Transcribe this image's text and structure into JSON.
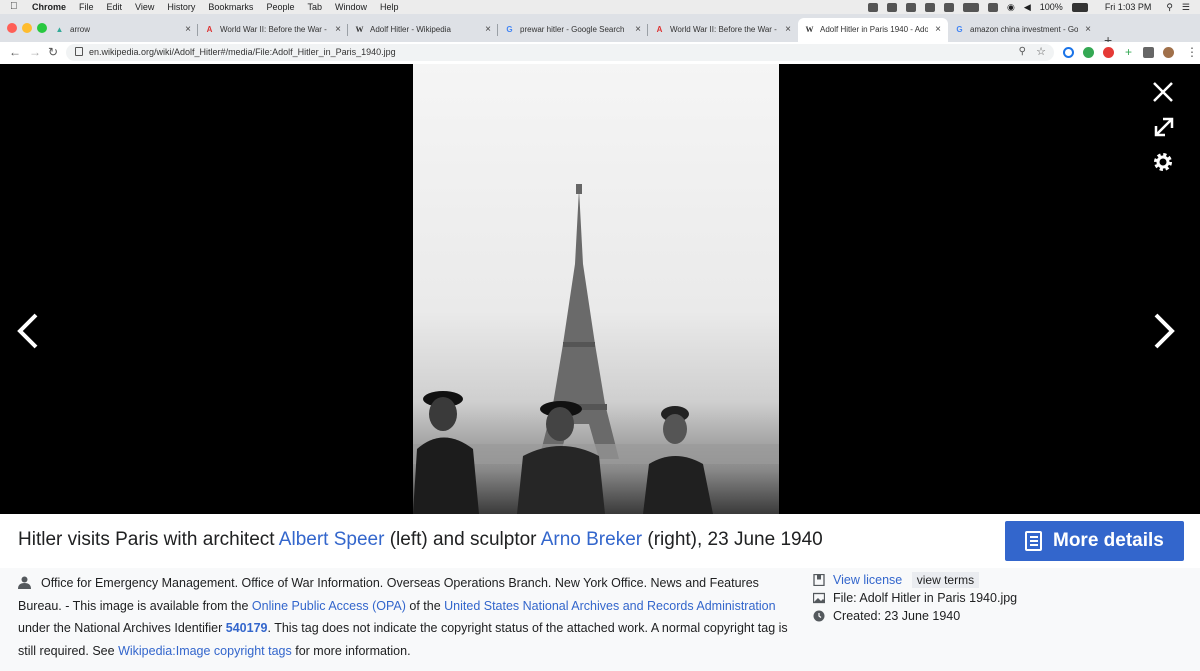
{
  "menubar": {
    "apple": "",
    "app": "Chrome",
    "menus": [
      "File",
      "Edit",
      "View",
      "History",
      "Bookmarks",
      "People",
      "Tab",
      "Window",
      "Help"
    ],
    "battery": "100%",
    "clock": "Fri 1:03 PM"
  },
  "tabs": [
    {
      "favicon": "▲",
      "title": "arrow",
      "close": "×"
    },
    {
      "favicon": "A",
      "title": "World War II: Before the War -",
      "close": "×"
    },
    {
      "favicon": "W",
      "title": "Adolf Hitler - Wikipedia",
      "close": "×"
    },
    {
      "favicon": "G",
      "title": "prewar hitler - Google Search",
      "close": "×"
    },
    {
      "favicon": "A",
      "title": "World War II: Before the War -",
      "close": "×"
    },
    {
      "favicon": "W",
      "title": "Adolf Hitler in Paris 1940 - Adol",
      "close": "×"
    },
    {
      "favicon": "G",
      "title": "amazon china investment - Goo",
      "close": "×"
    }
  ],
  "toolbar": {
    "url": "en.wikipedia.org/wiki/Adolf_Hitler#/media/File:Adolf_Hitler_in_Paris_1940.jpg"
  },
  "caption": {
    "t1": "Hitler visits Paris with architect ",
    "link1": "Albert Speer",
    "t2": " (left) and sculptor ",
    "link2": "Arno Breker",
    "t3": " (right), 23 June 1940"
  },
  "more_details": "More details",
  "description": {
    "t1": "Office for Emergency Management. Office of War Information. Overseas Operations Branch. New York Office. News and Features Bureau. - This image is available from the ",
    "link1": "Online Public Access (OPA)",
    "t2": " of the ",
    "link2": "United States National Archives and Records Administration",
    "t3": " under the National Archives Identifier ",
    "id": "540179",
    "t4": ". This tag does not indicate the copyright status of the attached work. A normal copyright tag is still required. See ",
    "link3": "Wikipedia:Image copyright tags",
    "t5": " for more information."
  },
  "meta": {
    "license": "View license",
    "view_terms": "view terms",
    "file": "File: Adolf Hitler in Paris 1940.jpg",
    "created": "Created: 23 June 1940"
  },
  "colors": {
    "link": "#3366cc",
    "accent": "#3366cc",
    "viewer_bg": "#000000"
  }
}
